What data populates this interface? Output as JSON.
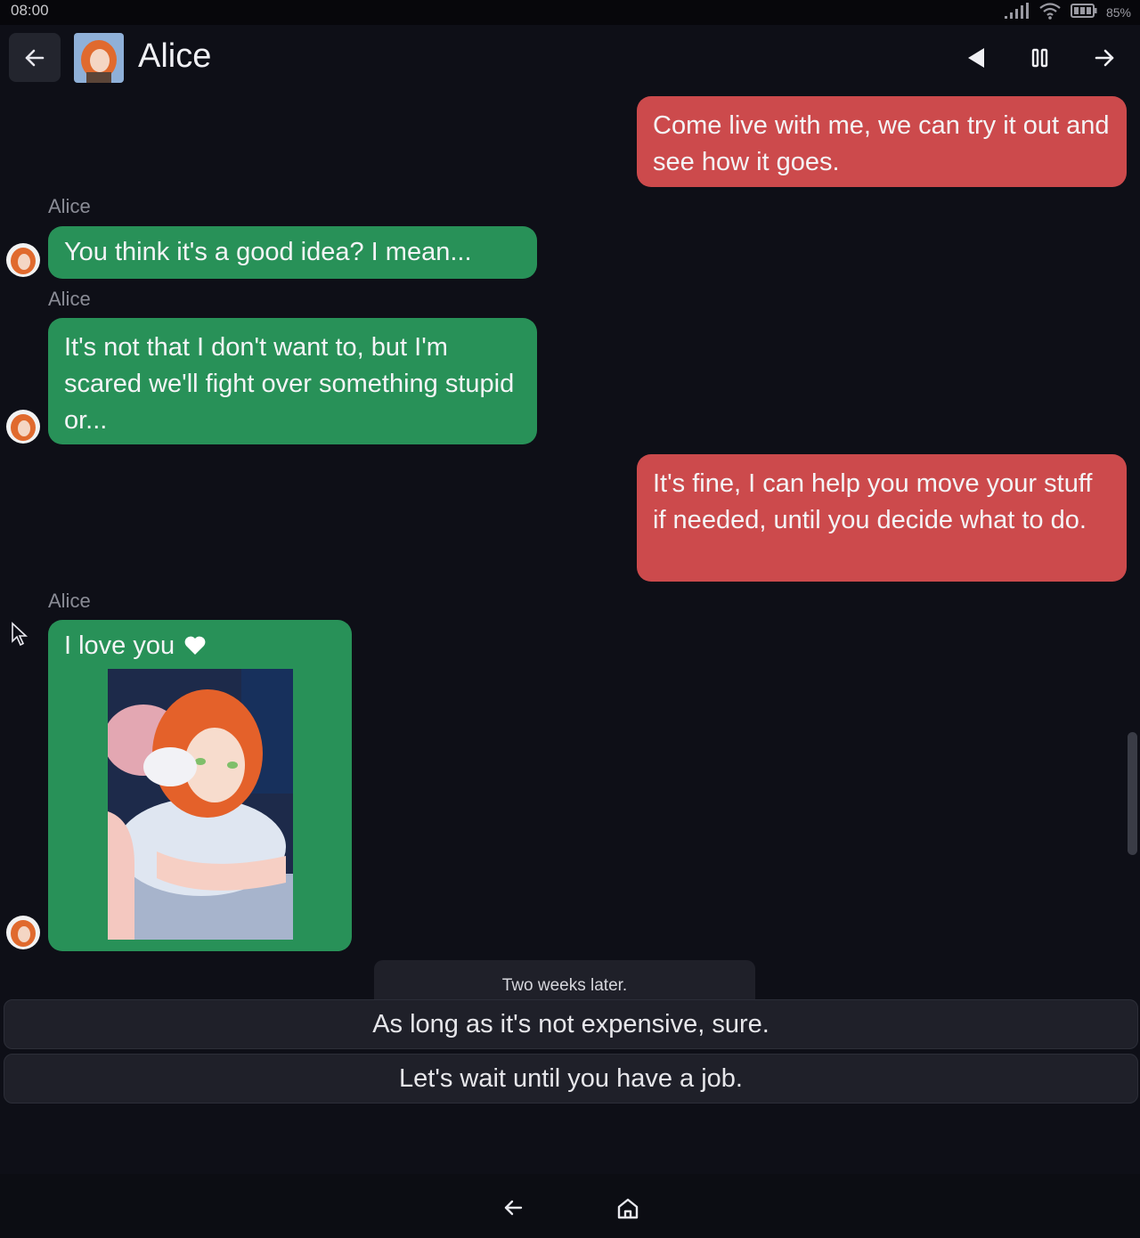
{
  "status_bar": {
    "time": "08:00",
    "battery": "85%",
    "icons": [
      "signal-icon",
      "wifi-icon",
      "battery-icon"
    ]
  },
  "header": {
    "title": "Alice",
    "icons": [
      "back-arrow-icon",
      "previous-icon",
      "pause-icon",
      "forward-arrow-icon"
    ]
  },
  "messages": [
    {
      "sender": "me",
      "text": "Come live with me, we can try it out and see how it goes."
    },
    {
      "sender": "Alice",
      "name_label": "Alice",
      "text": "You think it's a good idea? I mean..."
    },
    {
      "sender": "Alice",
      "name_label": "Alice",
      "text": "It's not that I don't want to, but I'm scared we'll fight over something stupid or..."
    },
    {
      "sender": "me",
      "text": "It's fine, I can help you move your stuff if needed, until you decide what to do."
    },
    {
      "sender": "Alice",
      "name_label": "Alice",
      "text": "I love you",
      "icon": "heart-icon",
      "has_image": true
    }
  ],
  "scene_divider": "Two weeks later.",
  "choices": [
    "As long as it's not expensive, sure.",
    "Let's wait until you have a job."
  ],
  "bottom_nav": {
    "icons": [
      "back-arrow-icon",
      "home-icon"
    ]
  },
  "colors": {
    "background": "#0e0f17",
    "my_bubble": "#cc4a4c",
    "alice_bubble": "#289158",
    "choice_bg": "#1f2029"
  }
}
